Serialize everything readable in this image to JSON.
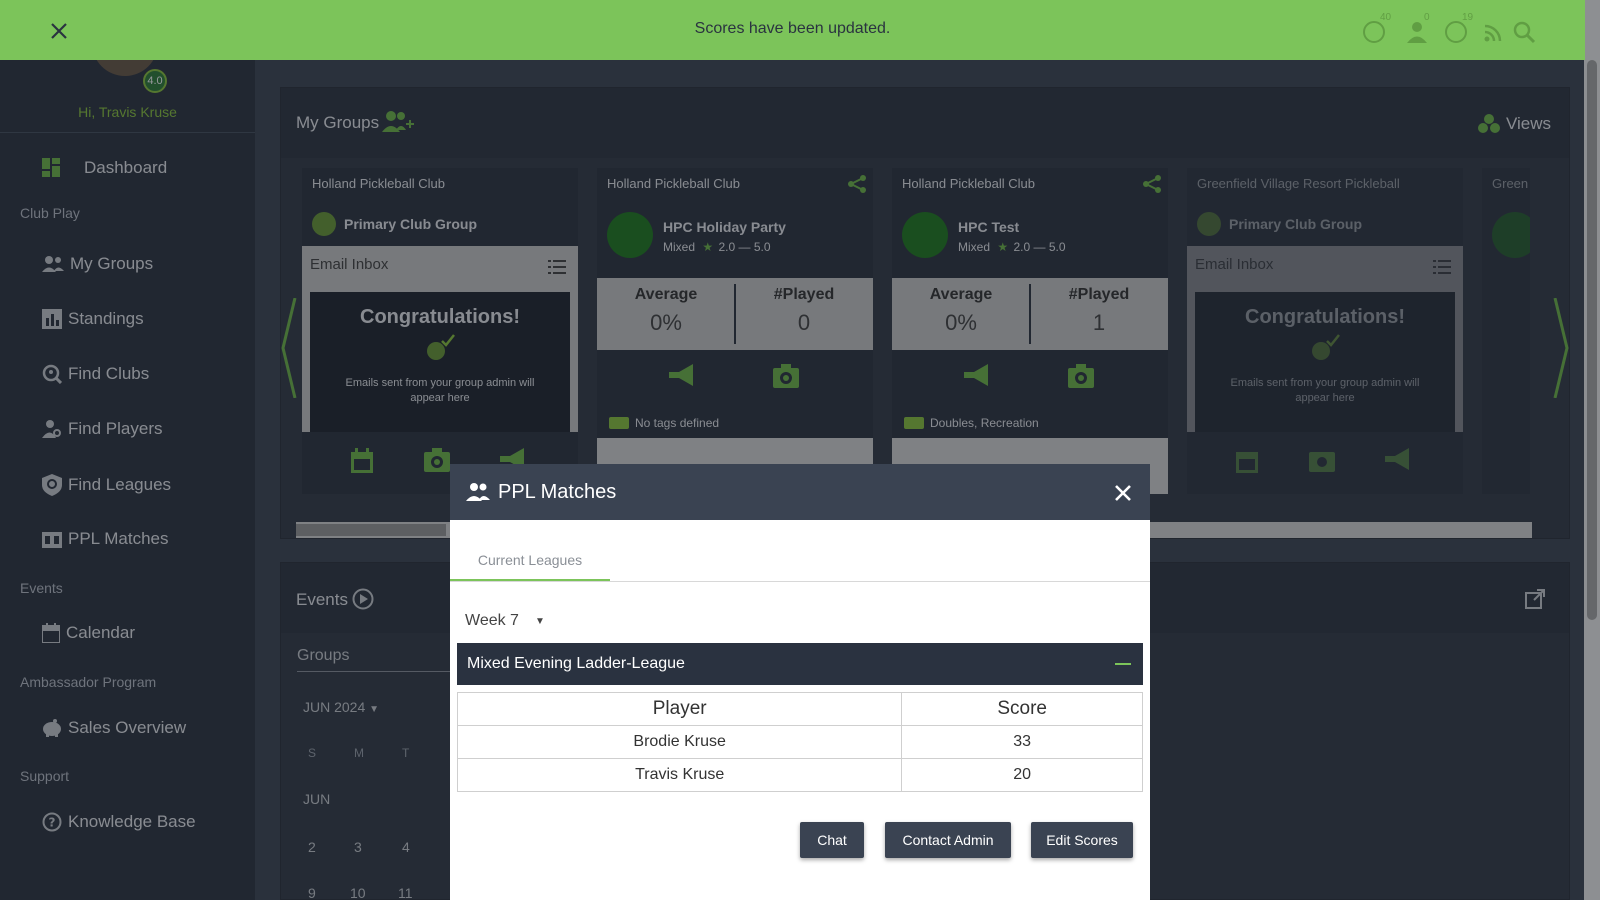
{
  "toast": {
    "message": "Scores have been updated."
  },
  "header": {
    "rating": "4.0",
    "badges": {
      "globe": "40",
      "people": "0",
      "chat": "19"
    }
  },
  "sidebar": {
    "greeting": "Hi, Travis Kruse",
    "dashboard": "Dashboard",
    "sections": {
      "club_play": "Club Play",
      "events": "Events",
      "ambassador": "Ambassador Program",
      "support": "Support"
    },
    "items": {
      "my_groups": "My Groups",
      "standings": "Standings",
      "find_clubs": "Find Clubs",
      "find_players": "Find Players",
      "find_leagues": "Find Leagues",
      "ppl_matches": "PPL Matches",
      "calendar": "Calendar",
      "sales_overview": "Sales Overview",
      "knowledge_base": "Knowledge Base"
    }
  },
  "groups_panel": {
    "title": "My Groups",
    "views": "Views",
    "cards": [
      {
        "club": "Holland Pickleball Club",
        "name": "Primary Club Group",
        "inbox": "Email Inbox",
        "congrats": "Congratulations!",
        "congrats_sub": "Emails sent from your group admin will appear here"
      },
      {
        "club": "Holland Pickleball Club",
        "name": "HPC Holiday Party",
        "mode": "Mixed",
        "range": "2.0 — 5.0",
        "avg_label": "Average",
        "avg": "0%",
        "played_label": "#Played",
        "played": "0",
        "tags": "No tags defined"
      },
      {
        "club": "Holland Pickleball Club",
        "name": "HPC Test",
        "mode": "Mixed",
        "range": "2.0 — 5.0",
        "avg_label": "Average",
        "avg": "0%",
        "played_label": "#Played",
        "played": "1",
        "tags": "Doubles, Recreation"
      },
      {
        "club": "Greenfield Village Resort Pickleball",
        "name": "Primary Club Group",
        "inbox": "Email Inbox",
        "congrats": "Congratulations!",
        "congrats_sub": "Emails sent from your group admin will appear here"
      }
    ],
    "partial_club": "Green"
  },
  "events_panel": {
    "title": "Events",
    "groups_label": "Groups",
    "month": "JUN 2024",
    "weekdays": [
      "S",
      "M",
      "T"
    ],
    "month_label": "JUN",
    "week1": [
      "2",
      "3",
      "4"
    ],
    "week2": [
      "9",
      "10",
      "11"
    ]
  },
  "modal": {
    "title": "PPL Matches",
    "tab": "Current Leagues",
    "week": "Week 7",
    "league": "Mixed Evening Ladder-League",
    "columns": [
      "Player",
      "Score"
    ],
    "rows": [
      {
        "player": "Brodie Kruse",
        "score": "33"
      },
      {
        "player": "Travis Kruse",
        "score": "20"
      }
    ],
    "buttons": {
      "chat": "Chat",
      "contact_admin": "Contact Admin",
      "edit_scores": "Edit Scores"
    }
  },
  "colors": {
    "accent": "#7cc45a",
    "sidebar": "#2c3340",
    "modal_header": "#3a4352"
  }
}
